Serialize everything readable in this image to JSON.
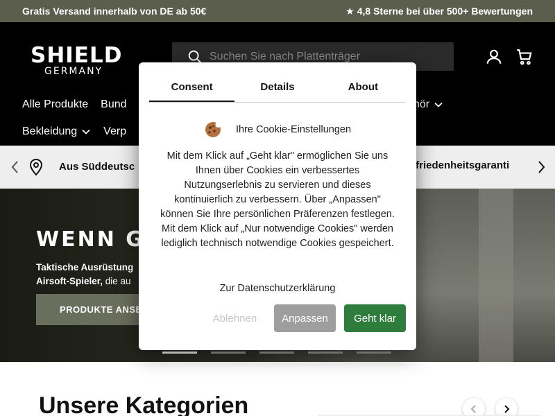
{
  "announcement": {
    "left": "Gratis Versand innerhalb von DE ab 50€",
    "rating_star": "★",
    "right": "4,8 Sterne bei über 500+ Bewertungen"
  },
  "header": {
    "logo_main": "SHIELD",
    "logo_sub": "GERMANY",
    "search_placeholder": "Suchen Sie nach Plattenträger",
    "nav_row1": [
      "Alle Produkte",
      "Bund",
      "hör"
    ],
    "nav_row2": [
      "Bekleidung",
      "Verp"
    ]
  },
  "usp": {
    "left_text": "Aus Süddeutsc",
    "right_text": "ufriedenheitsgaranti"
  },
  "hero": {
    "title": "WENN G",
    "subtitle_line1": "Taktische Ausrüstung",
    "subtitle_line2_bold": "Airsoft-Spieler,",
    "subtitle_line2_rest": " die au",
    "button": "PRODUKTE ANSE",
    "slides": 5,
    "active_slide": 1
  },
  "categories": {
    "title": "Unsere Kategorien"
  },
  "cookie_modal": {
    "tabs": [
      "Consent",
      "Details",
      "About"
    ],
    "active_tab": "Consent",
    "heading": "Ihre Cookie-Einstellungen",
    "text": "Mit dem Klick auf „Geht klar\" ermöglichen Sie uns Ihnen über Cookies ein verbessertes Nutzungserlebnis zu servieren und dieses kontinuierlich zu verbessern. Über „Anpassen\" können Sie Ihre persönlichen Präferenzen festlegen. Mit dem Klick auf „Nur notwendige Cookies\" werden lediglich technisch notwendige Cookies gespeichert.",
    "privacy_link": "Zur Datenschutzerklärung",
    "btn_necessary": "Ablehnen",
    "btn_customize": "Anpassen",
    "btn_accept": "Geht klar"
  },
  "colors": {
    "announcement_bg": "#5b5e4d",
    "header_bg": "#000000",
    "accept_green": "#2f7d3d",
    "customize_gray": "#9e9e9e"
  }
}
